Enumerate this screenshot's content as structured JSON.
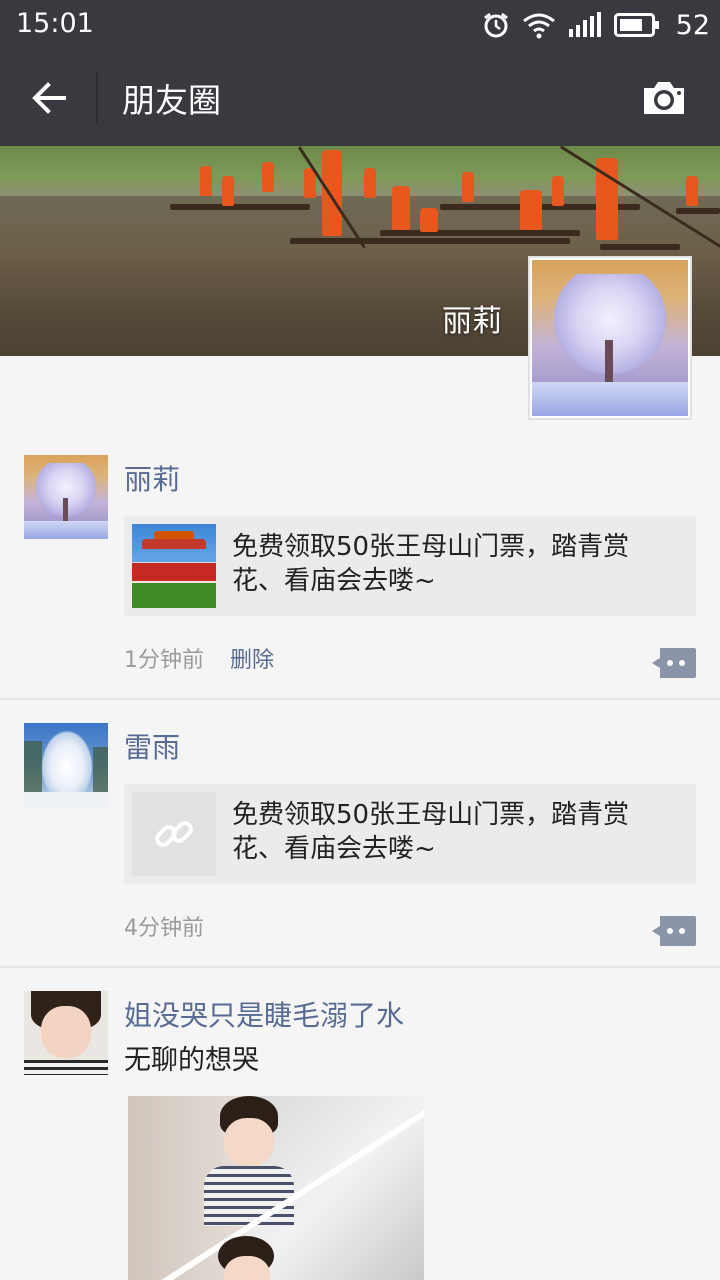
{
  "status_bar": {
    "time": "15:01",
    "battery": "52",
    "icons": [
      "alarm-icon",
      "wifi-icon",
      "signal-icon",
      "battery-icon"
    ]
  },
  "header": {
    "title": "朋友圈",
    "back_icon": "back-arrow-icon",
    "camera_icon": "camera-icon"
  },
  "cover": {
    "owner_name": "丽莉"
  },
  "posts": [
    {
      "user": "丽莉",
      "link_text": "免费领取50张王母山门票，踏青赏花、看庙会去喽~",
      "time": "1分钟前",
      "delete_label": "删除"
    },
    {
      "user": "雷雨",
      "link_text": "免费领取50张王母山门票，踏青赏花、看庙会去喽~",
      "time": "4分钟前"
    },
    {
      "user": "姐没哭只是睫毛溺了水",
      "text": "无聊的想哭"
    }
  ],
  "colors": {
    "header_bg": "#393a3f",
    "name_color": "#576b95",
    "card_bg": "#ebebeb",
    "page_bg": "#f5f5f5"
  }
}
